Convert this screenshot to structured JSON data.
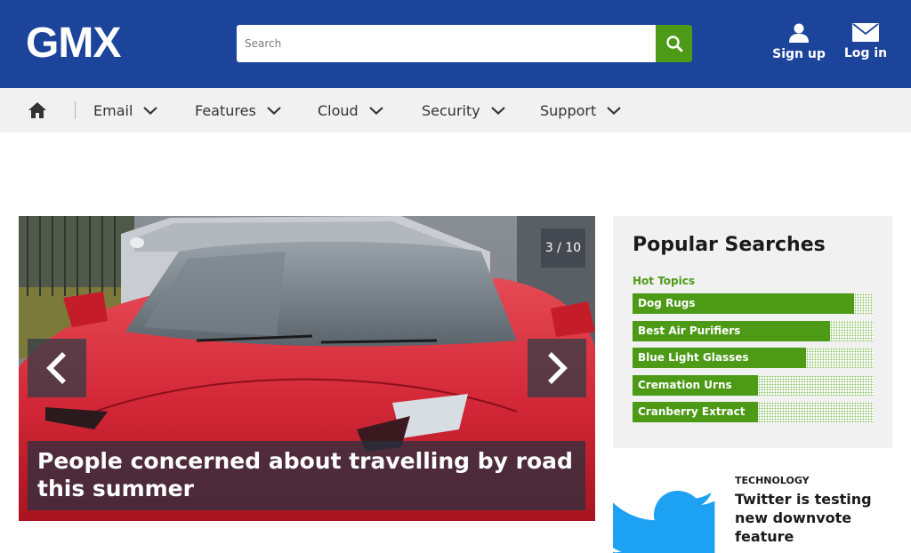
{
  "header": {
    "logo": "GMX",
    "search_placeholder": "Search",
    "signup_label": "Sign up",
    "login_label": "Log in",
    "search_icon": "search-icon",
    "user_icon": "user-icon",
    "mail_icon": "envelope-icon"
  },
  "nav": {
    "home_icon": "home-icon",
    "items": [
      {
        "label": "Email"
      },
      {
        "label": "Features"
      },
      {
        "label": "Cloud"
      },
      {
        "label": "Security"
      },
      {
        "label": "Support"
      }
    ]
  },
  "slider": {
    "counter": "3 / 10",
    "caption": "People concerned about travelling by road this summer",
    "prev_icon": "chevron-left-icon",
    "next_icon": "chevron-right-icon"
  },
  "popular": {
    "title": "Popular Searches",
    "subtitle": "Hot Topics",
    "items": [
      {
        "label": "Dog Rugs",
        "level": 0.92
      },
      {
        "label": "Best Air Purifiers",
        "level": 0.82
      },
      {
        "label": "Blue Light Glasses",
        "level": 0.72
      },
      {
        "label": "Cremation Urns",
        "level": 0.52
      },
      {
        "label": "Cranberry Extract",
        "level": 0.52
      }
    ]
  },
  "teaser": {
    "category": "TECHNOLOGY",
    "title": "Twitter is testing new downvote feature",
    "icon": "twitter-bird-icon"
  },
  "colors": {
    "header_bg": "#1c449b",
    "accent_green": "#4c9a16",
    "nav_bg": "#f1f1f1",
    "twitter_blue": "#1da1f2"
  }
}
